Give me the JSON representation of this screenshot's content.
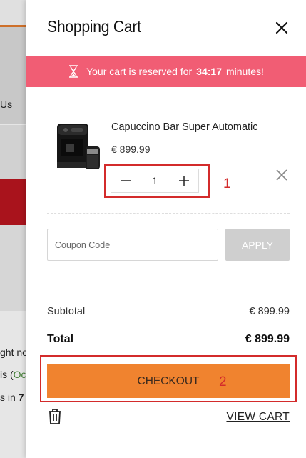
{
  "background": {
    "us_text": "Us",
    "line1": "ght no",
    "line2_prefix": "is (",
    "line2_highlight": "Oc",
    "line3_prefix": "s in ",
    "line3_bold": "7"
  },
  "cart": {
    "title": "Shopping Cart",
    "reservation": {
      "prefix": "Your cart is reserved for",
      "time": "34:17",
      "suffix": "minutes!"
    },
    "item": {
      "name": "Capuccino Bar Super Automatic",
      "price": "€ 899.99",
      "quantity": "1",
      "image_icon": "coffee-machine-image"
    },
    "annotations": {
      "qty_number": "1",
      "checkout_number": "2"
    },
    "coupon": {
      "placeholder": "Coupon Code",
      "value": "",
      "apply_label": "APPLY"
    },
    "summary": {
      "subtotal_label": "Subtotal",
      "subtotal_value": "€ 899.99",
      "total_label": "Total",
      "total_value": "€ 899.99"
    },
    "checkout_label": "CHECKOUT",
    "view_cart_label": "VIEW CART"
  },
  "colors": {
    "banner": "#f15d74",
    "checkout": "#f0832f",
    "apply_disabled": "#cfcfcf",
    "annotation_red": "#d32b2b"
  }
}
